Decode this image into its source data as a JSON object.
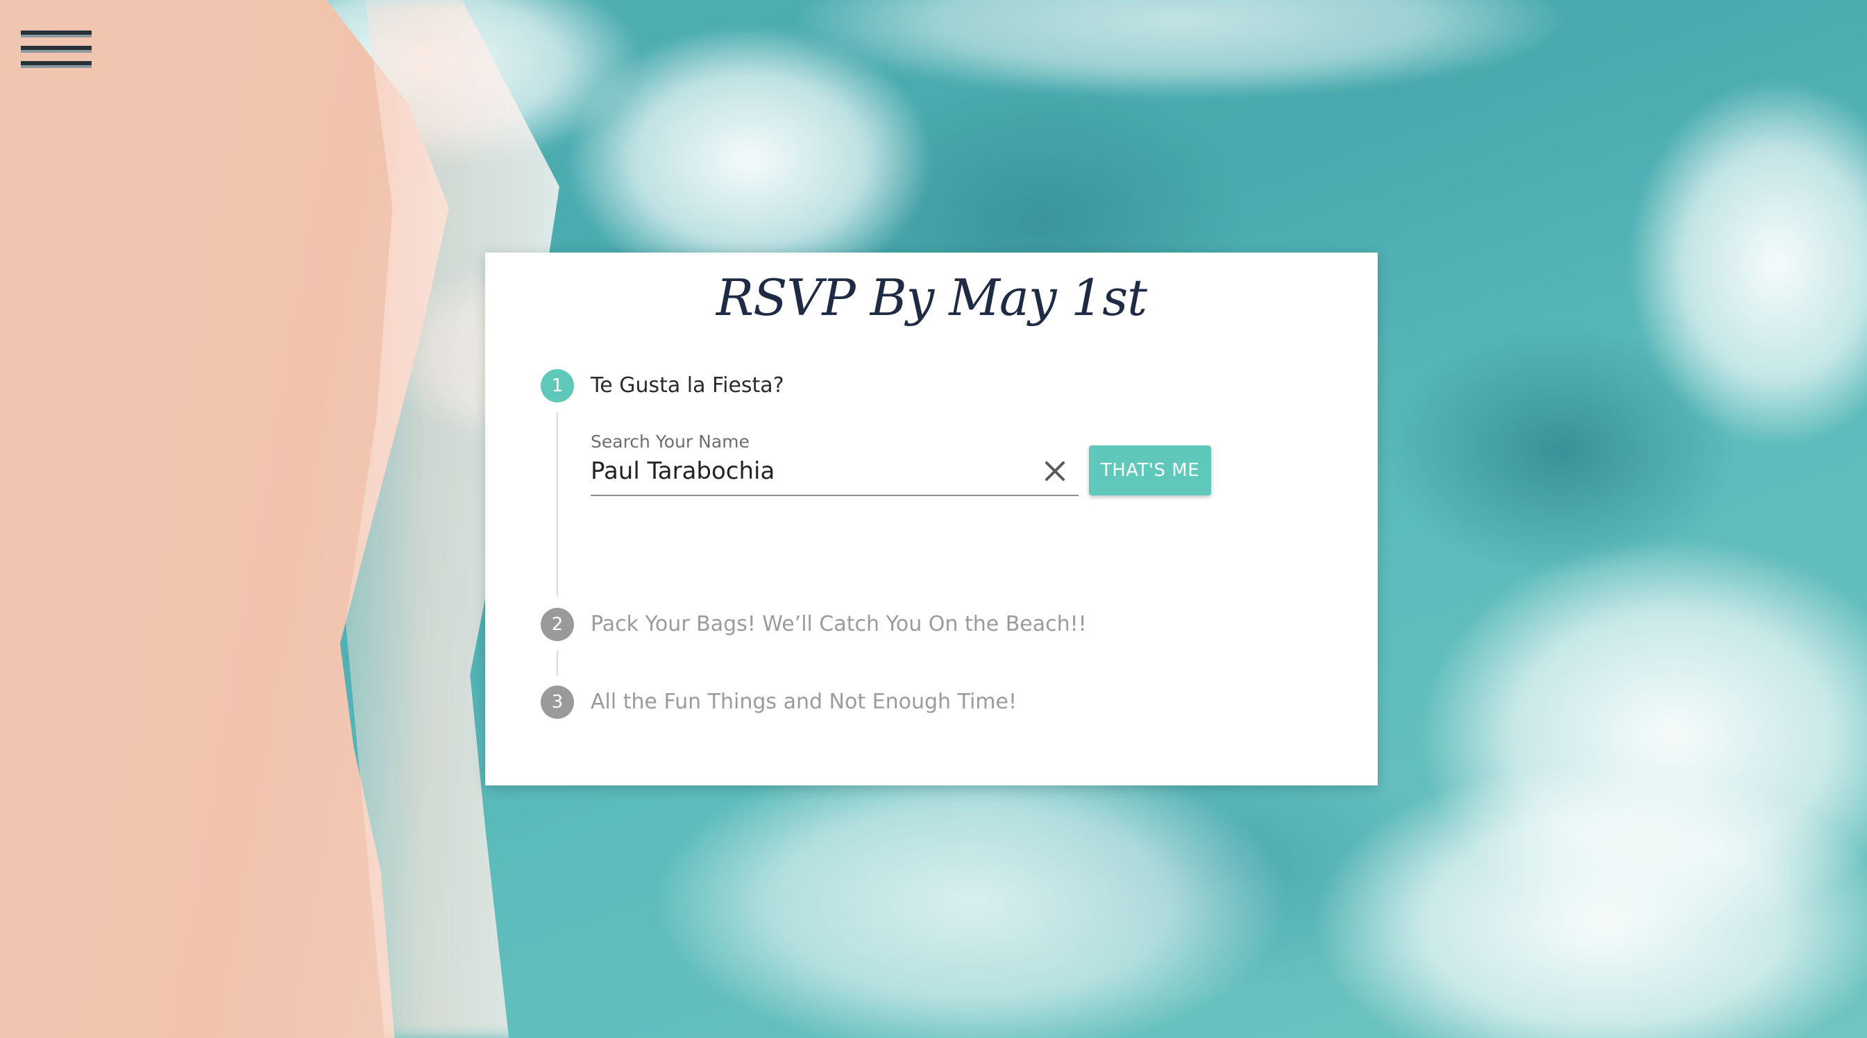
{
  "menu": {
    "icon": "hamburger-menu-icon"
  },
  "card": {
    "title": "RSVP By May 1st",
    "steps": [
      {
        "number": "1",
        "label": "Te Gusta la Fiesta?",
        "state": "active"
      },
      {
        "number": "2",
        "label": "Pack Your Bags! We’ll Catch You On the Beach!!",
        "state": "inactive"
      },
      {
        "number": "3",
        "label": "All the Fun Things and Not Enough Time!",
        "state": "inactive"
      }
    ],
    "search": {
      "label": "Search Your Name",
      "value": "Paul Tarabochia",
      "clear_icon": "close-icon"
    },
    "confirm_button": "THAT'S ME"
  },
  "colors": {
    "accent": "#5fc8bb",
    "inactive_step": "#9a9a9a",
    "title": "#1f2a44"
  }
}
